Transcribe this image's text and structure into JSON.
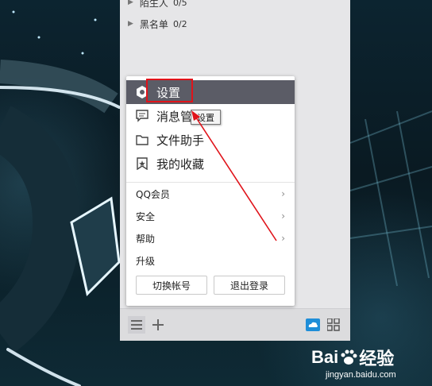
{
  "contact_groups": [
    {
      "name": "陌生人",
      "count": "0/5"
    },
    {
      "name": "黑名单",
      "count": "0/2"
    }
  ],
  "main_menu": {
    "big_items": [
      {
        "label": "设置",
        "icon": "settings-icon"
      },
      {
        "label": "消息管",
        "icon": "message-icon"
      },
      {
        "label": "文件助手",
        "icon": "folder-icon"
      },
      {
        "label": "我的收藏",
        "icon": "bookmark-icon"
      }
    ],
    "small_items": [
      {
        "label": "QQ会员",
        "has_submenu": true
      },
      {
        "label": "安全",
        "has_submenu": true
      },
      {
        "label": "帮助",
        "has_submenu": true
      },
      {
        "label": "升级",
        "has_submenu": false
      }
    ],
    "buttons": {
      "switch_account": "切换帐号",
      "logout": "退出登录"
    }
  },
  "tooltip": "设置",
  "bottom_bar": {
    "icons": [
      "menu-icon",
      "add-icon",
      "cloud-icon",
      "apps-grid-icon"
    ]
  },
  "watermark": {
    "brand": "Bai",
    "brand_cn": "经验",
    "domain": "jingyan.baidu.com"
  },
  "colors": {
    "active_menu_bg": "#5b5c66",
    "annotation_red": "#e0131a",
    "cloud_blue": "#1f8ed8"
  }
}
